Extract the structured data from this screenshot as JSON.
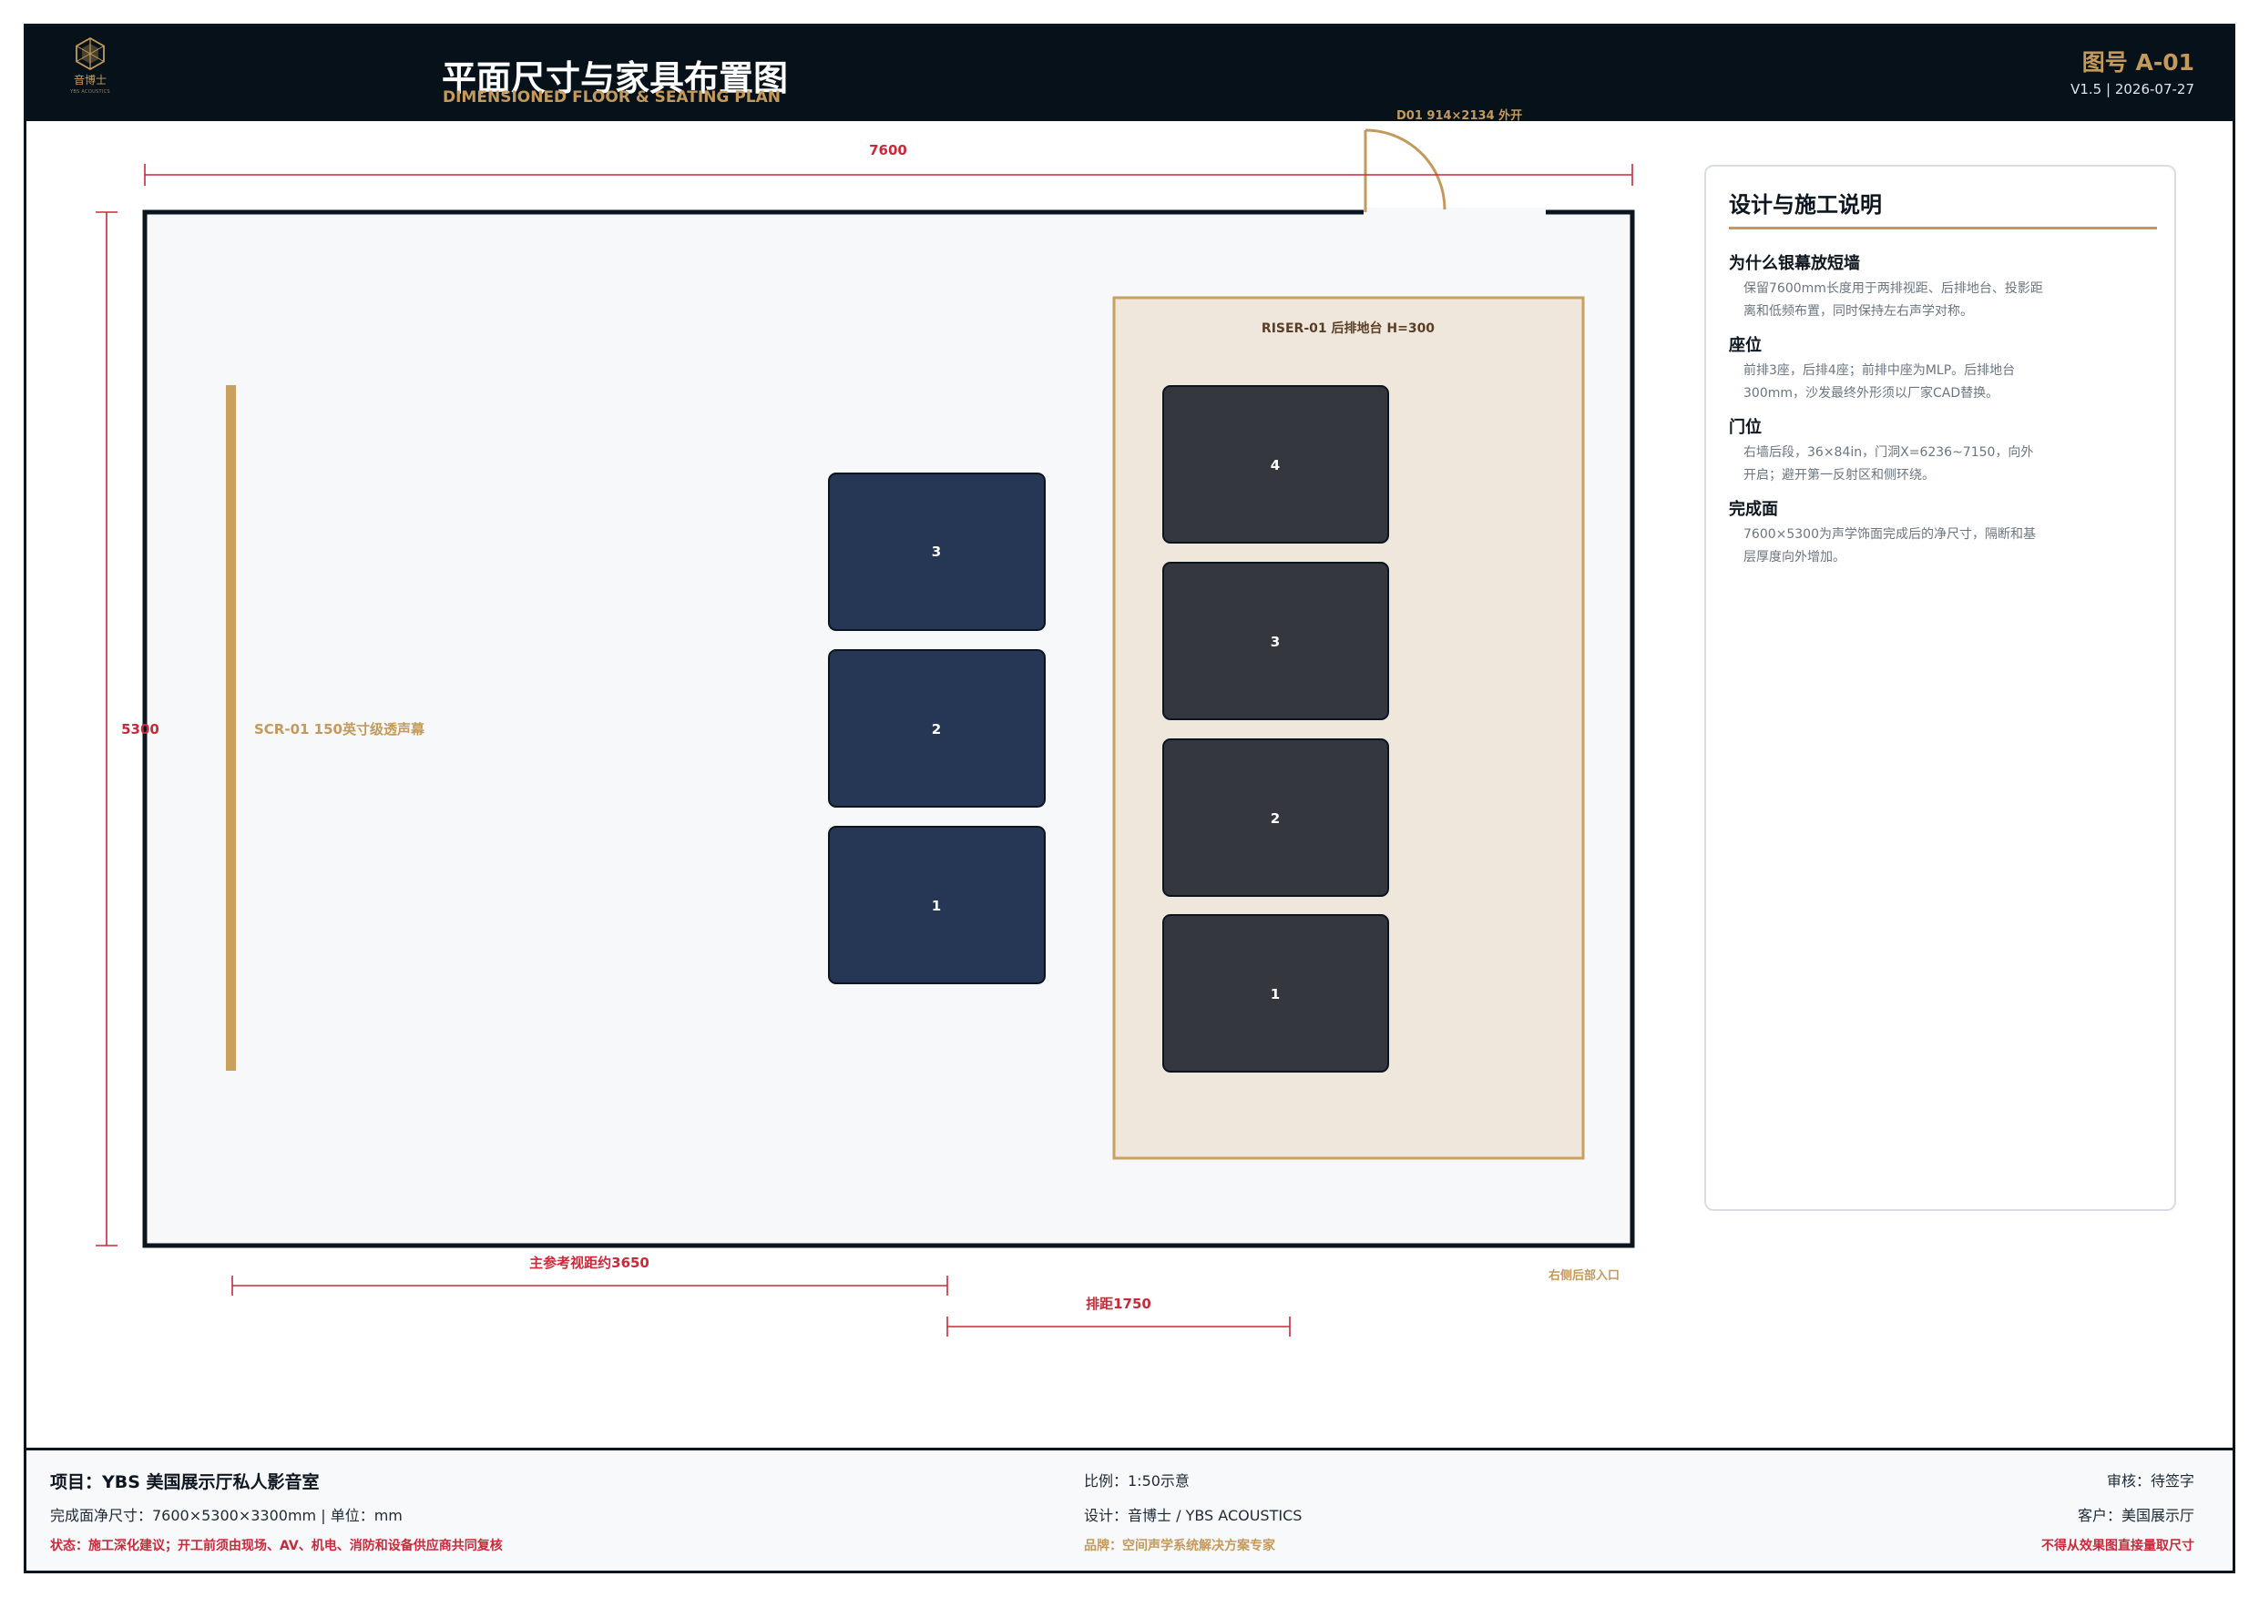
{
  "header": {
    "brand_cn": "音博士",
    "brand_en": "YBS ACOUSTICS",
    "title_cn": "平面尺寸与家具布置图",
    "title_en": "DIMENSIONED FLOOR & SEATING PLAN",
    "drawing_no": "图号 A-01",
    "version": "V1.5 | 2026-07-27"
  },
  "plan": {
    "room_width_label": "7600",
    "room_depth_label": "5300",
    "door_label": "D01 914×2134 外开",
    "screen_label": "SCR-01 150英寸级透声幕",
    "riser_label": "RISER-01 后排地台 H=300",
    "front_row_seats": [
      "3",
      "2",
      "1"
    ],
    "rear_row_seats": [
      "4",
      "3",
      "2",
      "1"
    ],
    "viewing_distance_label": "主参考视距约3650",
    "row_spacing_label": "排距1750",
    "entry_label": "右侧后部入口",
    "colors": {
      "wall": "#0b1520",
      "dimension": "#c92a3a",
      "accent": "#c49a5c",
      "front_seat": "#253754",
      "rear_seat": "#34373d",
      "riser_fill": "#f0e7dc",
      "room_fill": "#f6f8fa"
    }
  },
  "notes": {
    "title": "设计与施工说明",
    "items": [
      {
        "heading": "为什么银幕放短墙",
        "body": "保留7600mm长度用于两排视距、后排地台、投影距离和低频布置，同时保持左右声学对称。"
      },
      {
        "heading": "座位",
        "body": "前排3座，后排4座；前排中座为MLP。后排地台300mm，沙发最终外形须以厂家CAD替换。"
      },
      {
        "heading": "门位",
        "body": "右墙后段，36×84in，门洞X=6236~7150，向外开启；避开第一反射区和侧环绕。"
      },
      {
        "heading": "完成面",
        "body": "7600×5300为声学饰面完成后的净尺寸，隔断和基层厚度向外增加。"
      }
    ]
  },
  "footer": {
    "project": "项目：YBS 美国展示厅私人影音室",
    "size": "完成面净尺寸：7600×5300×3300mm | 单位：mm",
    "status": "状态：施工深化建议；开工前须由现场、AV、机电、消防和设备供应商共同复核",
    "scale": "比例：1:50示意",
    "design": "设计：音博士 / YBS ACOUSTICS",
    "brand": "品牌：空间声学系统解决方案专家",
    "review": "审核：待签字",
    "client": "客户：美国展示厅",
    "warning": "不得从效果图直接量取尺寸"
  }
}
